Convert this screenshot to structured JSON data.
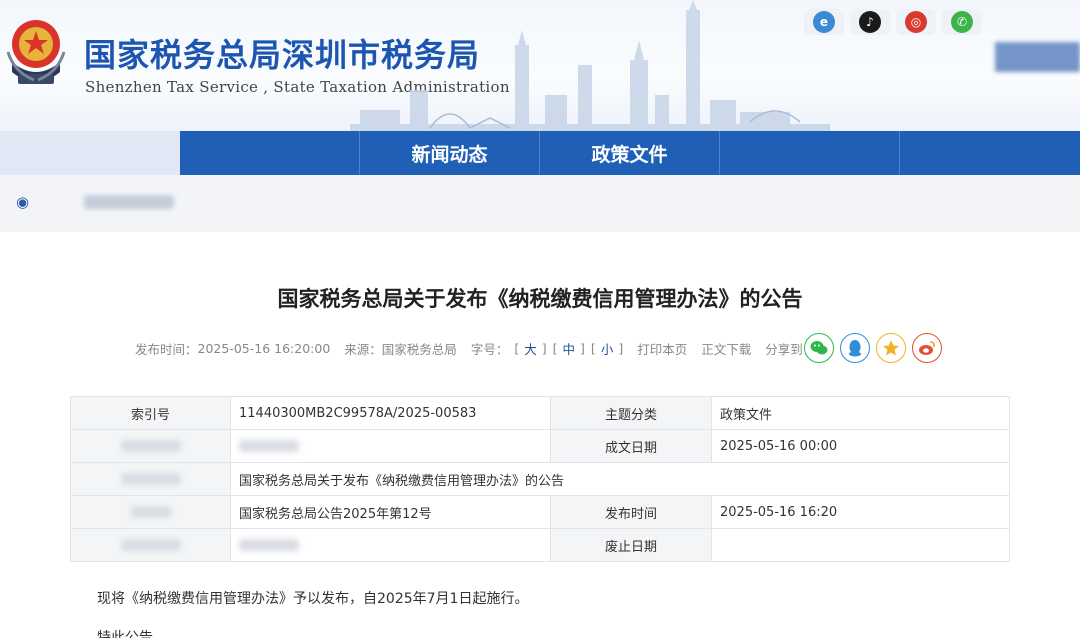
{
  "header": {
    "site_title": "国家税务总局深圳市税务局",
    "site_subtitle": "Shenzhen Tax Service , State Taxation Administration"
  },
  "nav": {
    "items": [
      "",
      "新闻动态",
      "政策文件",
      "",
      ""
    ]
  },
  "article": {
    "title": "国家税务总局关于发布《纳税缴费信用管理办法》的公告",
    "meta": {
      "publish_label": "发布时间：",
      "publish_time": "2025-05-16 16:20:00",
      "source_label": "来源：",
      "source": "国家税务总局",
      "font_label": "字号：",
      "font_large": "大",
      "font_medium": "中",
      "font_small": "小",
      "print": "打印本页",
      "download": "正文下载",
      "share_label": "分享到："
    }
  },
  "info_table": {
    "index_label": "索引号",
    "index_value": "11440300MB2C99578A/2025-00583",
    "topic_label": "主题分类",
    "topic_value": "政策文件",
    "date_label": "成文日期",
    "date_value": "2025-05-16 00:00",
    "title_value": "国家税务总局关于发布《纳税缴费信用管理办法》的公告",
    "doc_no_value": "国家税务总局公告2025年第12号",
    "release_label": "发布时间",
    "release_value": "2025-05-16 16:20",
    "repeal_label": "废止日期",
    "repeal_value": ""
  },
  "body": {
    "para1": "现将《纳税缴费信用管理办法》予以发布，自2025年7月1日起施行。",
    "para2": "特此公告。"
  },
  "colors": {
    "brand_blue": "#1f5fb6",
    "title_blue": "#1d56b0",
    "wechat": "#2fb84a",
    "qq": "#2f8ed6",
    "qzone": "#f0b323",
    "weibo": "#e2502f"
  }
}
